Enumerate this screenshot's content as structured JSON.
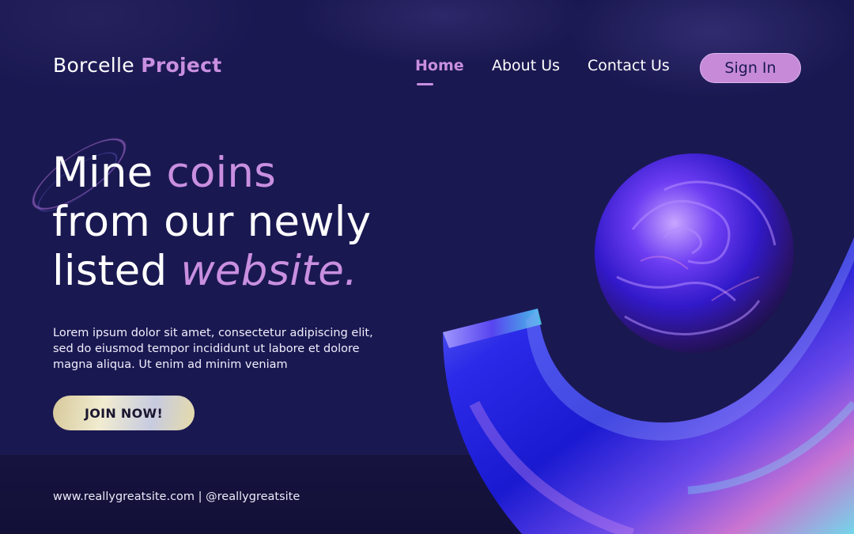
{
  "header": {
    "brand_regular": "Borcelle",
    "brand_bold": "Project",
    "nav": {
      "home": "Home",
      "about": "About Us",
      "contact": "Contact Us"
    },
    "sign_in": "Sign In"
  },
  "hero": {
    "line1_a": "Mine",
    "line1_b": "coins",
    "line2": "from our newly",
    "line3_a": "listed",
    "line3_b": "website."
  },
  "description": "Lorem ipsum dolor sit amet, consectetur adipiscing elit, sed do eiusmod tempor incididunt ut labore et dolore magna aliqua. Ut enim ad minim veniam",
  "cta": {
    "label": "JOIN NOW!"
  },
  "footer": {
    "contact": "www.reallygreatsite.com | @reallygreatsite"
  },
  "colors": {
    "background": "#1a1851",
    "accent": "#c98fe0",
    "text": "#ffffff"
  },
  "icons": {
    "decor_ring": "ring-decoration",
    "sphere": "iridescent-sphere",
    "arc": "iridescent-arc"
  }
}
